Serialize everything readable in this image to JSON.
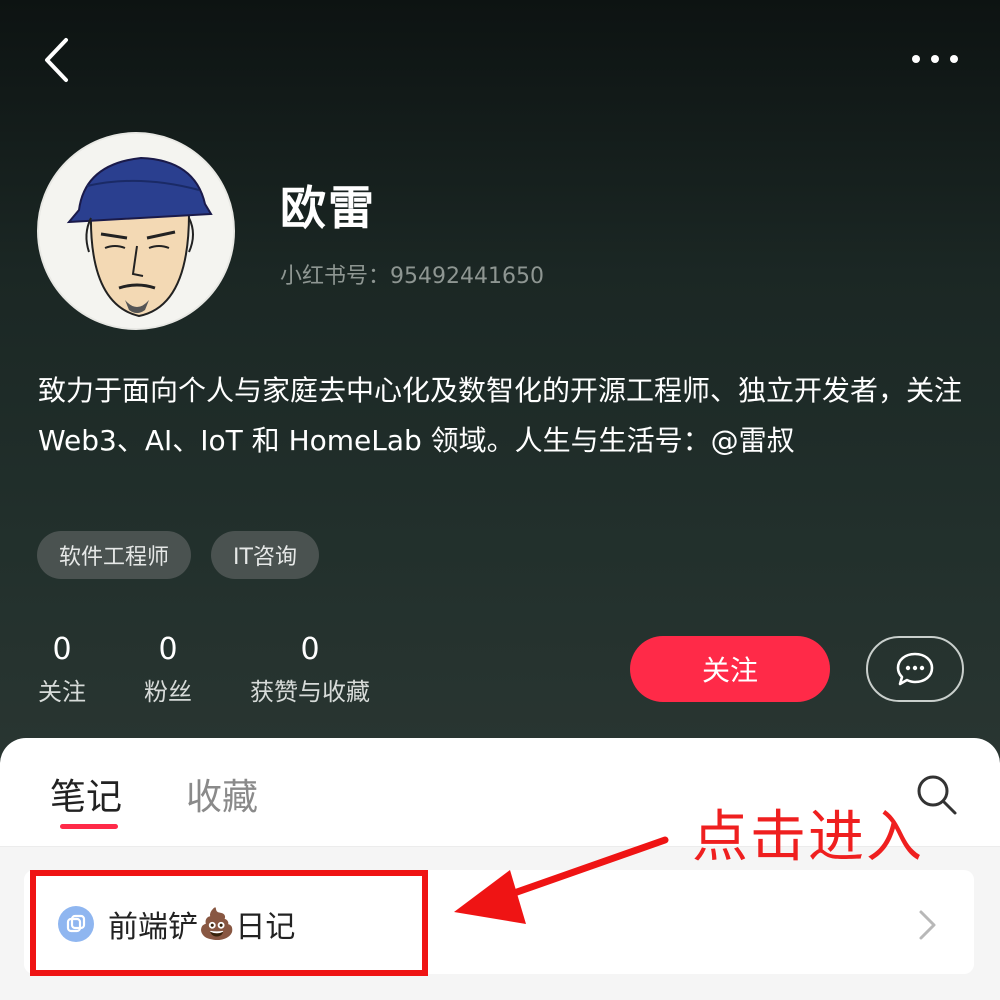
{
  "profile": {
    "name": "欧雷",
    "red_id": "小红书号：95492441650",
    "bio": "致力于面向个人与家庭去中心化及数智化的开源工程师、独立开发者，关注 Web3、AI、IoT 和 HomeLab 领域。人生与生活号：@雷叔",
    "tags": [
      "软件工程师",
      "IT咨询"
    ]
  },
  "stats": [
    {
      "value": "0",
      "label": "关注"
    },
    {
      "value": "0",
      "label": "粉丝"
    },
    {
      "value": "0",
      "label": "获赞与收藏"
    }
  ],
  "actions": {
    "follow_label": "关注"
  },
  "tabs": [
    {
      "label": "笔记",
      "active": true
    },
    {
      "label": "收藏",
      "active": false
    }
  ],
  "collection": {
    "title_prefix": "前端铲",
    "emoji": "💩",
    "title_suffix": "日记"
  },
  "annotation": {
    "callout": "点击进入"
  },
  "colors": {
    "accent": "#ff2a48",
    "annotation_red": "#ef1414"
  }
}
